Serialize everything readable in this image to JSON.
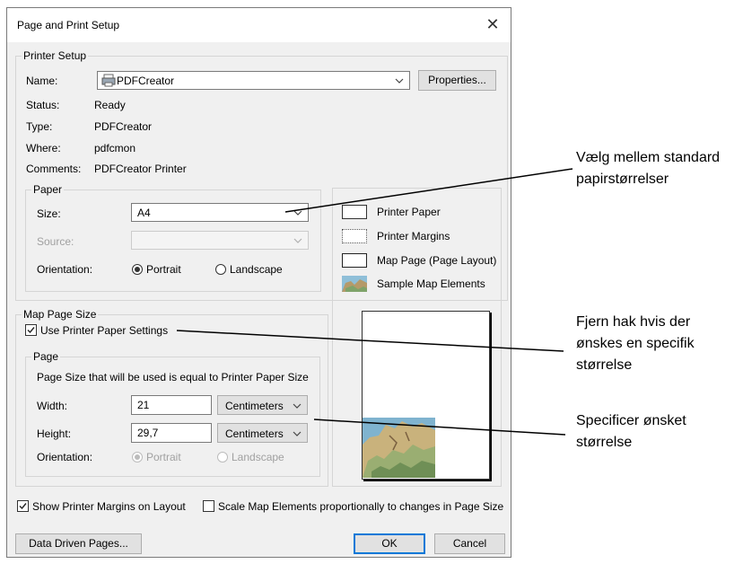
{
  "dialog": {
    "title": "Page and Print Setup",
    "close_icon": "close-icon"
  },
  "printer_setup": {
    "group_label": "Printer Setup",
    "name_label": "Name:",
    "name_value": "PDFCreator",
    "properties_button": "Properties...",
    "status_label": "Status:",
    "status_value": "Ready",
    "type_label": "Type:",
    "type_value": "PDFCreator",
    "where_label": "Where:",
    "where_value": "pdfcmon",
    "comments_label": "Comments:",
    "comments_value": "PDFCreator Printer"
  },
  "paper": {
    "group_label": "Paper",
    "size_label": "Size:",
    "size_value": "A4",
    "source_label": "Source:",
    "source_value": "",
    "orientation_label": "Orientation:",
    "portrait_label": "Portrait",
    "landscape_label": "Landscape",
    "selected_orientation": "Portrait"
  },
  "legend": {
    "printer_paper": "Printer Paper",
    "printer_margins": "Printer Margins",
    "map_page": "Map Page (Page Layout)",
    "sample_map": "Sample Map Elements"
  },
  "map_page_size": {
    "group_label": "Map Page Size",
    "use_printer_paper_label": "Use Printer Paper Settings",
    "use_printer_paper_checked": true,
    "page_group_label": "Page",
    "info_text": "Page Size that will be used is equal to Printer Paper Size",
    "width_label": "Width:",
    "width_value": "21",
    "width_unit": "Centimeters",
    "height_label": "Height:",
    "height_value": "29,7",
    "height_unit": "Centimeters",
    "orientation_label": "Orientation:",
    "portrait_label": "Portrait",
    "landscape_label": "Landscape"
  },
  "options": {
    "show_margins_label": "Show Printer Margins on Layout",
    "show_margins_checked": true,
    "scale_elements_label": "Scale Map Elements proportionally to changes in Page Size",
    "scale_elements_checked": false
  },
  "buttons": {
    "data_driven": "Data Driven Pages...",
    "ok": "OK",
    "cancel": "Cancel"
  },
  "annotations": {
    "note1_line1": "Vælg mellem standard",
    "note1_line2": "papirstørrelser",
    "note2_line1": "Fjern hak hvis der",
    "note2_line2": "ønskes en specifik",
    "note2_line3": "størrelse",
    "note3_line1": "Specificer ønsket",
    "note3_line2": "størrelse"
  }
}
